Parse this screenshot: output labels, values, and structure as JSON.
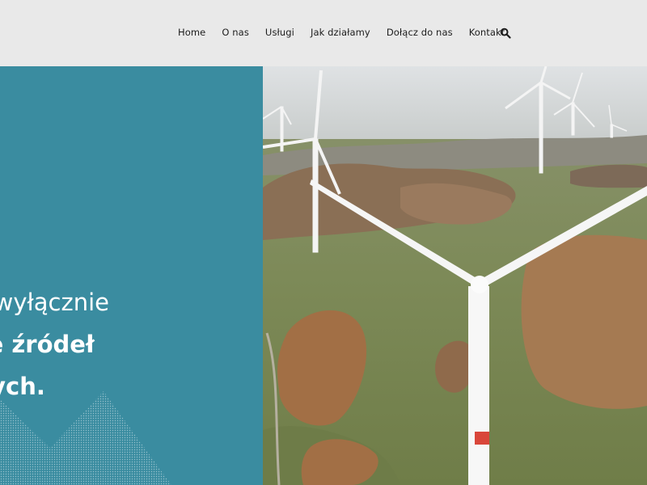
{
  "nav": {
    "items": [
      {
        "label": "Home"
      },
      {
        "label": "O nas"
      },
      {
        "label": "Usługi"
      },
      {
        "label": "Jak działamy"
      },
      {
        "label": "Dołącz do nas"
      },
      {
        "label": "Kontakt"
      }
    ],
    "search_icon": "search-icon"
  },
  "hero": {
    "tagline_line1": "my wyłącznie",
    "tagline_line2": "e ze źródeł",
    "tagline_line3": "alnych.",
    "panel_color": "#3a8ca0",
    "photo": "wind-turbines-field-photo"
  }
}
